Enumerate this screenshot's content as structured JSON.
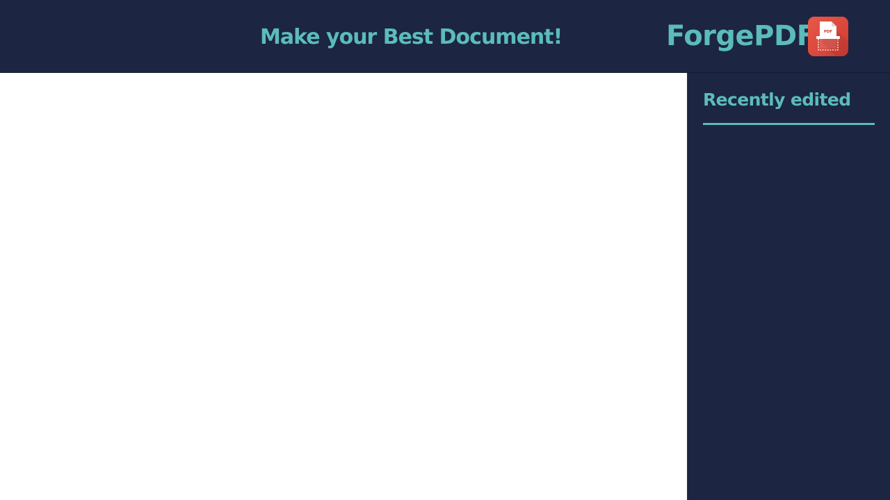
{
  "header": {
    "tagline": "Make your Best Document!",
    "brand": {
      "name": "ForgePDF",
      "logo_icon": "pdf-scanner-icon",
      "logo_label": "PDF",
      "accent_color": "#5bbcba",
      "logo_color": "#e2503f"
    },
    "background_color": "#1c2541"
  },
  "sidebar": {
    "title": "Recently edited",
    "items": []
  },
  "main": {
    "background_color": "#ffffff"
  }
}
